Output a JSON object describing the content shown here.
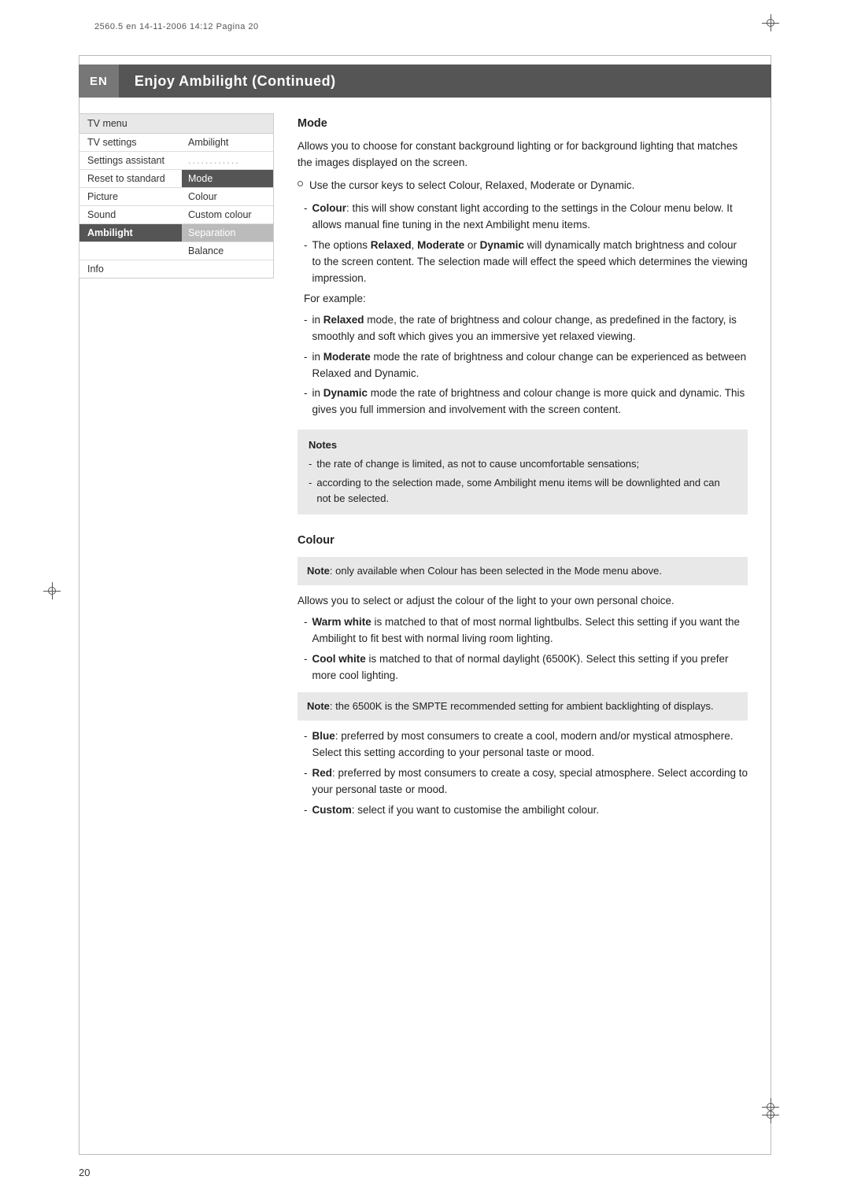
{
  "meta": {
    "line": "2560.5 en  14-11-2006  14:12  Pagina 20"
  },
  "title_bar": {
    "badge": "EN",
    "title": "Enjoy Ambilight  (Continued)"
  },
  "sidebar": {
    "menu_title": "TV menu",
    "rows": [
      {
        "left": "TV settings",
        "right": "Ambilight",
        "left_style": "normal",
        "right_style": "normal"
      },
      {
        "left": "Settings assistant",
        "right": "............",
        "left_style": "normal",
        "right_style": "dotted"
      },
      {
        "left": "Reset to standard",
        "right": "Mode",
        "left_style": "normal",
        "right_style": "highlighted"
      },
      {
        "left": "Picture",
        "right": "Colour",
        "left_style": "normal",
        "right_style": "normal"
      },
      {
        "left": "Sound",
        "right": "Custom colour",
        "left_style": "normal",
        "right_style": "normal"
      },
      {
        "left": "Ambilight",
        "right": "Separation",
        "left_style": "ambilight",
        "right_style": "separator"
      },
      {
        "left": "",
        "right": "Balance",
        "left_style": "normal",
        "right_style": "normal"
      },
      {
        "left": "Info",
        "right": "",
        "left_style": "info",
        "right_style": "normal"
      }
    ]
  },
  "mode_section": {
    "heading": "Mode",
    "para1": "Allows you to choose for constant background lighting or for background lighting that matches the images displayed on the screen.",
    "bullet1": "Use the cursor keys to select Colour, Relaxed, Moderate or Dynamic.",
    "dash_items": [
      {
        "text_plain": ": this will show constant light according to the settings in the Colour menu below. It allows manual fine tuning in the next Ambilight menu items.",
        "bold_word": "Colour"
      },
      {
        "text_plain": "The options ",
        "bold_words": [
          "Relaxed",
          "Moderate",
          "Dynamic"
        ],
        "rest": " will dynamically match brightness and colour to the screen content. The selection made will effect the speed which determines the viewing impression."
      }
    ],
    "for_example": "For example:",
    "examples": [
      {
        "bold": "Relaxed",
        "text": " mode, the rate of brightness and colour change, as predefined in the factory, is smoothly and soft which gives you an immersive yet relaxed viewing."
      },
      {
        "bold": "Moderate",
        "text": " mode the rate of brightness and colour change can be experienced as between Relaxed and Dynamic."
      },
      {
        "bold": "Dynamic",
        "text": " mode the rate of brightness and colour change is more quick and dynamic. This gives you full immersion and involvement with the screen content."
      }
    ],
    "notes_title": "Notes",
    "notes": [
      "the rate of change is limited, as not to cause uncomfortable sensations;",
      "according to the selection made, some Ambilight menu items will be downlighted and can not be selected."
    ]
  },
  "colour_section": {
    "heading": "Colour",
    "note_text": "Note: only available when Colour has been selected in the Mode menu above.",
    "para1": "Allows you to select or adjust the colour of the light to your own personal choice.",
    "items": [
      {
        "bold": "Warm white",
        "text": " is matched to that of most normal lightbulbs. Select this setting if you want the Ambilight to fit best with normal living room lighting."
      },
      {
        "bold": "Cool white",
        "text": " is matched to that of normal daylight (6500K). Select this setting if you prefer more cool lighting."
      }
    ],
    "note2": "Note: the 6500K is the SMPTE recommended setting for ambient backlighting of displays.",
    "items2": [
      {
        "bold": "Blue",
        "text": ": preferred by most consumers to create a cool, modern and/or mystical atmosphere. Select this setting according to your personal taste or mood."
      },
      {
        "bold": "Red",
        "text": ": preferred by most consumers to create a cosy, special atmosphere. Select according to your personal taste or mood."
      },
      {
        "bold": "Custom",
        "text": ": select if you want to customise the ambilight colour."
      }
    ]
  },
  "page_number": "20"
}
